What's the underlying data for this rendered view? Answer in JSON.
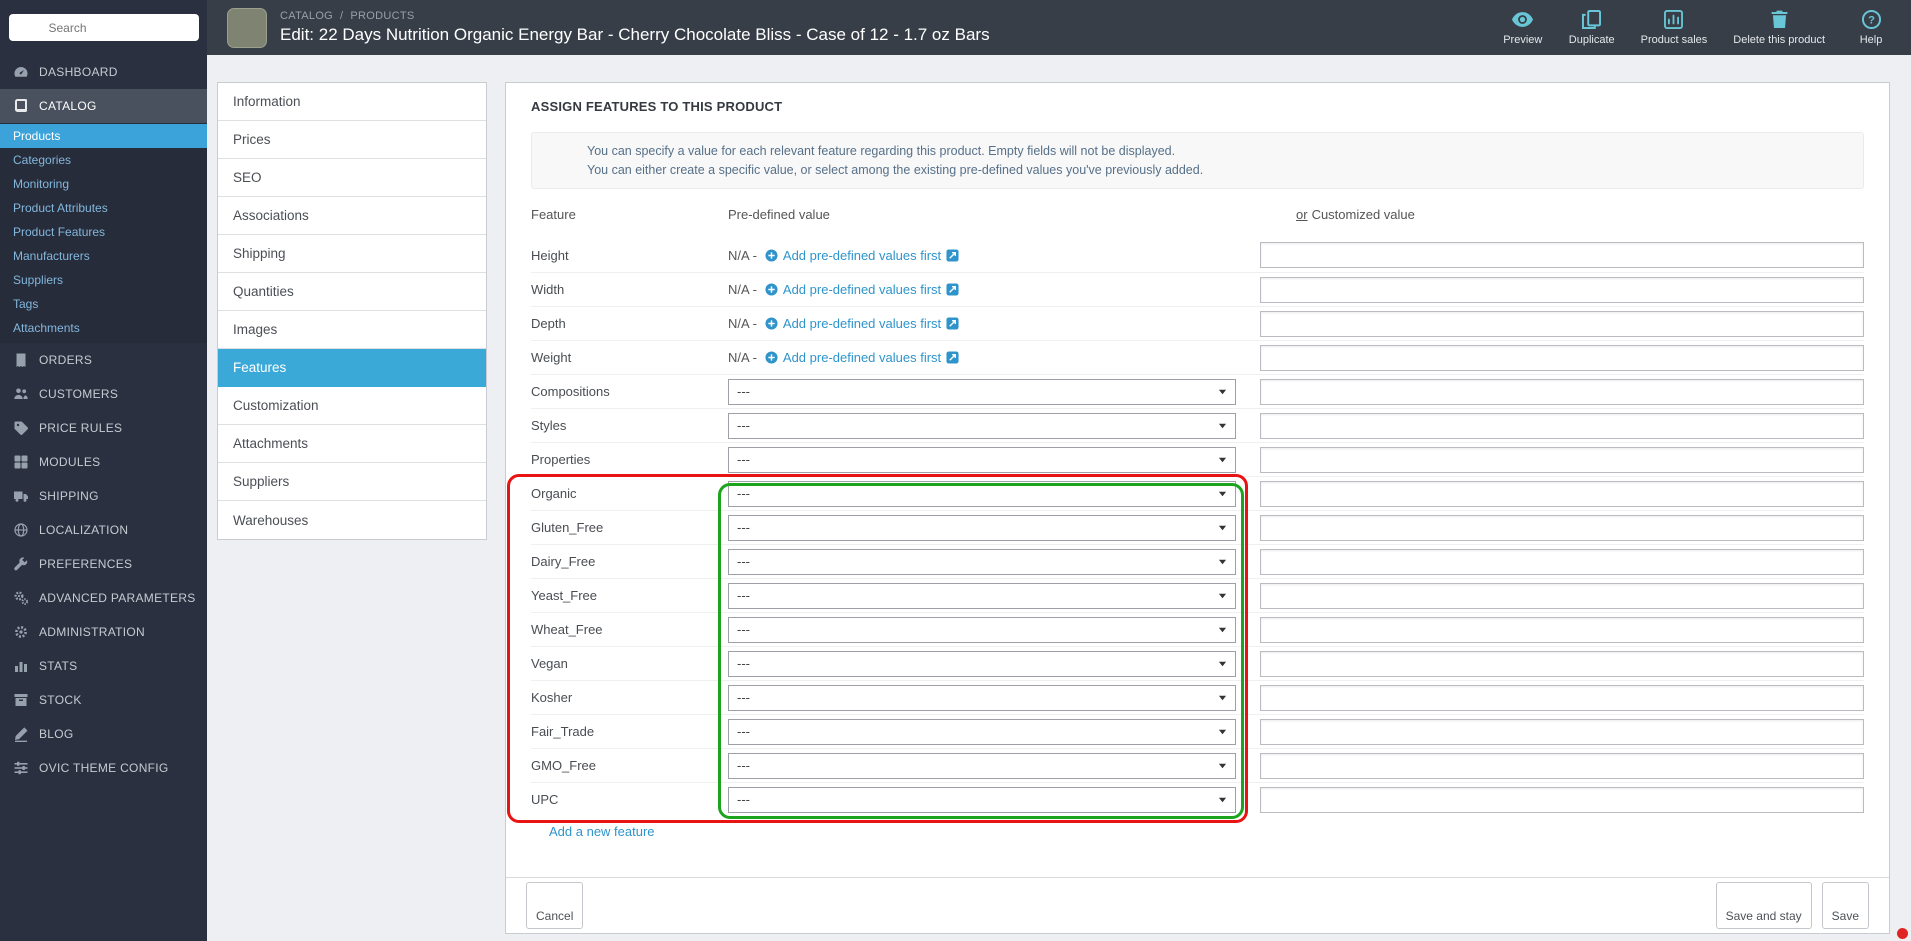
{
  "colors": {
    "topbar_bg": "#373e48",
    "sidebar_bg": "#2a3040",
    "accent_blue": "#3ba9d8",
    "link_blue": "#2e94cb",
    "icon_teal": "#68c6d6",
    "annotation_red": "#e81414",
    "annotation_green": "#1da41d"
  },
  "topbar": {
    "search": {
      "placeholder": "Search"
    },
    "breadcrumb": {
      "items": [
        "CATALOG",
        "PRODUCTS"
      ],
      "separator": "/"
    },
    "title": "Edit: 22 Days Nutrition Organic Energy Bar - Cherry Chocolate Bliss - Case of 12 - 1.7 oz Bars",
    "actions": [
      {
        "label": "Preview",
        "icon": "eye-icon"
      },
      {
        "label": "Duplicate",
        "icon": "duplicate-icon"
      },
      {
        "label": "Product sales",
        "icon": "product-sales-icon"
      },
      {
        "label": "Delete this product",
        "icon": "trash-icon"
      },
      {
        "label": "Help",
        "icon": "help-icon"
      }
    ]
  },
  "sidebar": {
    "items": [
      {
        "label": "DASHBOARD",
        "icon": "speedometer-icon"
      },
      {
        "label": "CATALOG",
        "icon": "catalog-book-icon",
        "active": true,
        "submenu": [
          "Products",
          "Categories",
          "Monitoring",
          "Product Attributes",
          "Product Features",
          "Manufacturers",
          "Suppliers",
          "Tags",
          "Attachments"
        ],
        "selected_submenu": "Products"
      },
      {
        "label": "ORDERS",
        "icon": "orders-icon"
      },
      {
        "label": "CUSTOMERS",
        "icon": "customers-icon"
      },
      {
        "label": "PRICE RULES",
        "icon": "price-tag-icon"
      },
      {
        "label": "MODULES",
        "icon": "modules-icon"
      },
      {
        "label": "SHIPPING",
        "icon": "truck-icon"
      },
      {
        "label": "LOCALIZATION",
        "icon": "globe-icon"
      },
      {
        "label": "PREFERENCES",
        "icon": "preferences-wrench-icon"
      },
      {
        "label": "ADVANCED PARAMETERS",
        "icon": "advanced-parameters-gears-icon"
      },
      {
        "label": "ADMINISTRATION",
        "icon": "administration-gear-icon"
      },
      {
        "label": "STATS",
        "icon": "stats-bars-icon"
      },
      {
        "label": "STOCK",
        "icon": "stock-box-icon"
      },
      {
        "label": "BLOG",
        "icon": "blog-pencil-icon"
      },
      {
        "label": "OVIC THEME CONFIG",
        "icon": "theme-config-icon"
      }
    ]
  },
  "product_tabs": {
    "items": [
      "Information",
      "Prices",
      "SEO",
      "Associations",
      "Shipping",
      "Quantities",
      "Images",
      "Features",
      "Customization",
      "Attachments",
      "Suppliers",
      "Warehouses"
    ],
    "selected": "Features"
  },
  "panel": {
    "title": "ASSIGN FEATURES TO THIS PRODUCT",
    "hint": {
      "line1": "You can specify a value for each relevant feature regarding this product. Empty fields will not be displayed.",
      "line2": "You can either create a specific value, or select among the existing pre-defined values you've previously added."
    },
    "table": {
      "headers": {
        "feature": "Feature",
        "predefined": "Pre-defined value",
        "or_word": "or",
        "customized": "Customized value"
      },
      "na_text": "N/A -",
      "add_predefined_label": "Add pre-defined values first",
      "rows": [
        {
          "name": "Height",
          "type": "na"
        },
        {
          "name": "Width",
          "type": "na"
        },
        {
          "name": "Depth",
          "type": "na"
        },
        {
          "name": "Weight",
          "type": "na"
        },
        {
          "name": "Compositions",
          "type": "select",
          "value": "---"
        },
        {
          "name": "Styles",
          "type": "select",
          "value": "---"
        },
        {
          "name": "Properties",
          "type": "select",
          "value": "---"
        },
        {
          "name": "Organic",
          "type": "select",
          "value": "---"
        },
        {
          "name": "Gluten_Free",
          "type": "select",
          "value": "---"
        },
        {
          "name": "Dairy_Free",
          "type": "select",
          "value": "---"
        },
        {
          "name": "Yeast_Free",
          "type": "select",
          "value": "---"
        },
        {
          "name": "Wheat_Free",
          "type": "select",
          "value": "---"
        },
        {
          "name": "Vegan",
          "type": "select",
          "value": "---"
        },
        {
          "name": "Kosher",
          "type": "select",
          "value": "---"
        },
        {
          "name": "Fair_Trade",
          "type": "select",
          "value": "---"
        },
        {
          "name": "GMO_Free",
          "type": "select",
          "value": "---"
        },
        {
          "name": "UPC",
          "type": "select",
          "value": "---"
        }
      ]
    },
    "add_feature_label": "Add a new feature",
    "footer": {
      "cancel_label": "Cancel",
      "save_and_stay_label": "Save and stay",
      "save_label": "Save"
    }
  },
  "annotations": {
    "red_rows_start": "Organic",
    "red_rows_end": "UPC"
  }
}
